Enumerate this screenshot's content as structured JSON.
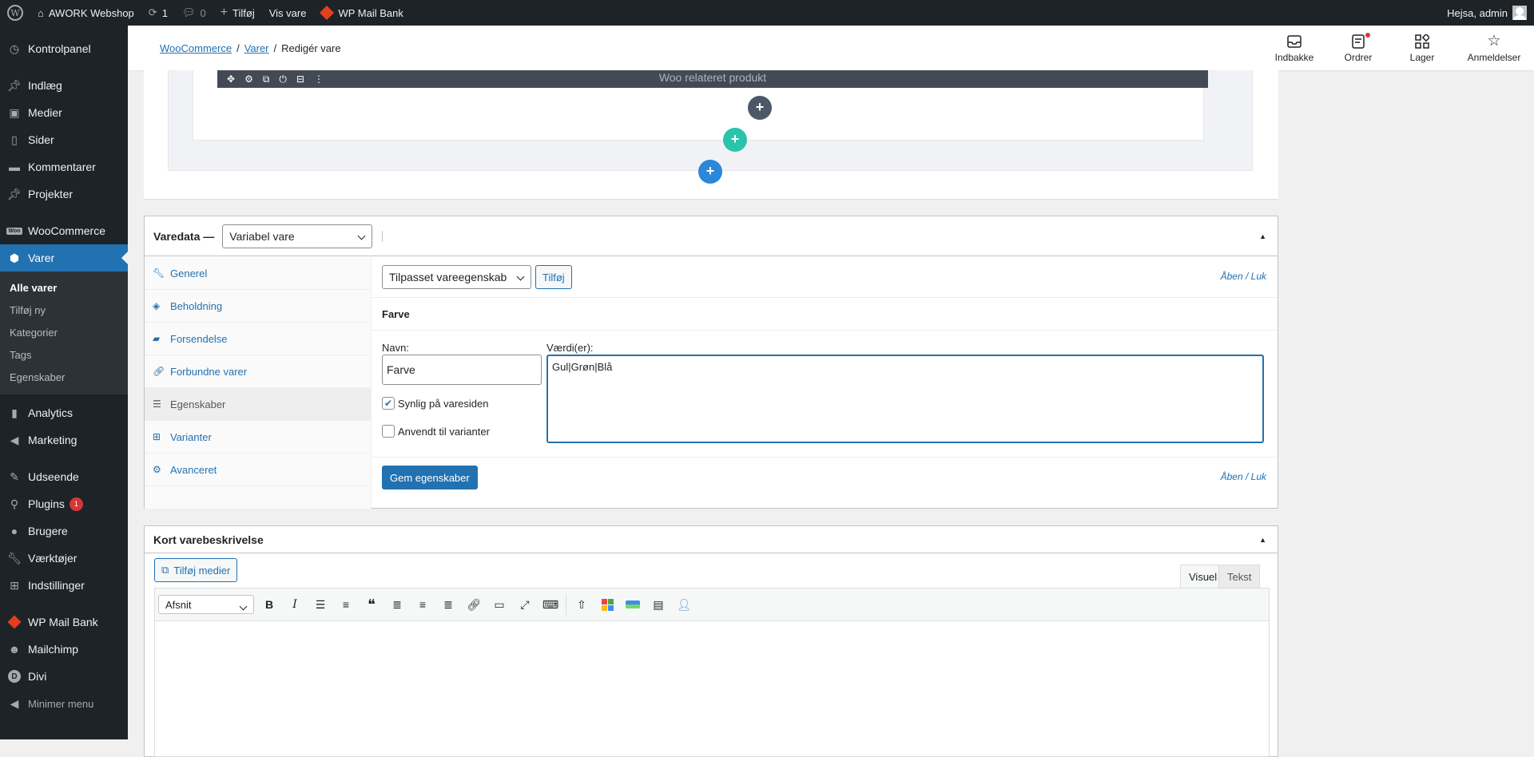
{
  "adminbar": {
    "site": "AWORK Webshop",
    "updates": "1",
    "comments": "0",
    "new": "Tilføj",
    "view": "Vis vare",
    "mailbank": "WP Mail Bank",
    "greeting": "Hejsa, admin"
  },
  "sidebar": {
    "items": [
      "Kontrolpanel",
      "Indlæg",
      "Medier",
      "Sider",
      "Kommentarer",
      "Projekter",
      "WooCommerce",
      "Varer"
    ],
    "sub": [
      "Alle varer",
      "Tilføj ny",
      "Kategorier",
      "Tags",
      "Egenskaber"
    ],
    "items2": [
      "Analytics",
      "Marketing",
      "Udseende",
      "Plugins",
      "Brugere",
      "Værktøjer",
      "Indstillinger",
      "WP Mail Bank",
      "Mailchimp",
      "Divi",
      "Minimer menu"
    ],
    "plugins_badge": "1"
  },
  "header": {
    "crumb1": "WooCommerce",
    "crumb2": "Varer",
    "crumb3": "Redigér vare",
    "sep": "/",
    "actions": [
      "Indbakke",
      "Ordrer",
      "Lager",
      "Anmeldelser"
    ]
  },
  "builder": {
    "module": "Woo relateret produkt",
    "plus": "+"
  },
  "product_data": {
    "title": "Varedata —",
    "type": "Variabel vare",
    "tabs": [
      "Generel",
      "Beholdning",
      "Forsendelse",
      "Forbundne varer",
      "Egenskaber",
      "Varianter",
      "Avanceret"
    ],
    "attr_select": "Tilpasset vareegenskab",
    "add_btn": "Tilføj",
    "expand": "Åben / Luk",
    "attr_title": "Farve",
    "name_label": "Navn:",
    "name_value": "Farve",
    "values_label": "Værdi(er):",
    "values_value": "Gul|Grøn|Blå",
    "visible_label": "Synlig på varesiden",
    "variations_label": "Anvendt til varianter",
    "save_btn": "Gem egenskaber"
  },
  "short_desc": {
    "title": "Kort varebeskrivelse",
    "add_media": "Tilføj medier",
    "tab_visual": "Visuel",
    "tab_text": "Tekst",
    "format": "Afsnit"
  }
}
